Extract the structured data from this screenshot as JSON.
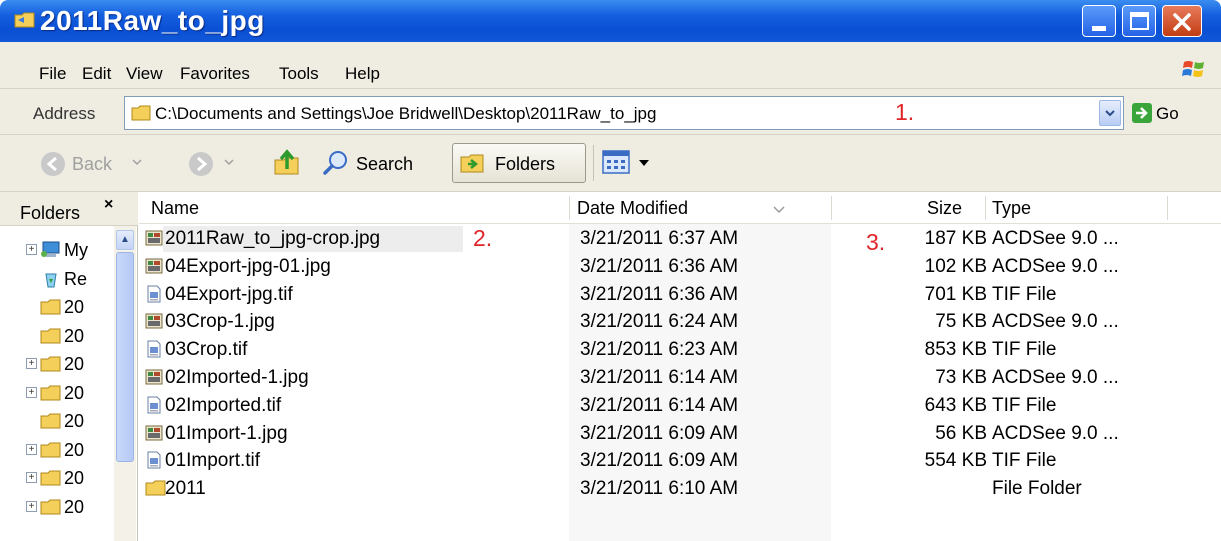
{
  "window": {
    "title": "2011Raw_to_jpg"
  },
  "menu": {
    "items": [
      "File",
      "Edit",
      "View",
      "Favorites",
      "Tools",
      "Help"
    ]
  },
  "address": {
    "label": "Address",
    "value": "C:\\Documents and Settings\\Joe Bridwell\\Desktop\\2011Raw_to_jpg",
    "go_label": "Go"
  },
  "annotations": {
    "a1": "1.",
    "a2": "2.",
    "a3": "3."
  },
  "toolbar": {
    "back_label": "Back",
    "search_label": "Search",
    "folders_label": "Folders"
  },
  "folders_pane": {
    "title": "Folders",
    "close": "×",
    "tree": [
      {
        "label": "My",
        "icon": "my-computer-icon",
        "expander": true
      },
      {
        "label": "Re",
        "icon": "recycle-bin-icon",
        "expander": false
      },
      {
        "label": "20",
        "icon": "folder-icon",
        "expander": false
      },
      {
        "label": "20",
        "icon": "folder-icon",
        "expander": false
      },
      {
        "label": "20",
        "icon": "folder-icon",
        "expander": true
      },
      {
        "label": "20",
        "icon": "folder-icon",
        "expander": true
      },
      {
        "label": "20",
        "icon": "folder-icon",
        "expander": false
      },
      {
        "label": "20",
        "icon": "folder-icon",
        "expander": true
      },
      {
        "label": "20",
        "icon": "folder-icon",
        "expander": true
      },
      {
        "label": "20",
        "icon": "folder-icon",
        "expander": true
      }
    ]
  },
  "columns": {
    "name": "Name",
    "date": "Date Modified",
    "size": "Size",
    "type": "Type"
  },
  "files": [
    {
      "name": "2011Raw_to_jpg-crop.jpg",
      "date": "3/21/2011 6:37 AM",
      "size": "187 KB",
      "type": "ACDSee 9.0 ...",
      "icon": "jpg-file-icon"
    },
    {
      "name": "04Export-jpg-01.jpg",
      "date": "3/21/2011 6:36 AM",
      "size": "102 KB",
      "type": "ACDSee 9.0 ...",
      "icon": "jpg-file-icon"
    },
    {
      "name": "04Export-jpg.tif",
      "date": "3/21/2011 6:36 AM",
      "size": "701 KB",
      "type": "TIF File",
      "icon": "tif-file-icon"
    },
    {
      "name": "03Crop-1.jpg",
      "date": "3/21/2011 6:24 AM",
      "size": "75 KB",
      "type": "ACDSee 9.0 ...",
      "icon": "jpg-file-icon"
    },
    {
      "name": "03Crop.tif",
      "date": "3/21/2011 6:23 AM",
      "size": "853 KB",
      "type": "TIF File",
      "icon": "tif-file-icon"
    },
    {
      "name": "02Imported-1.jpg",
      "date": "3/21/2011 6:14 AM",
      "size": "73 KB",
      "type": "ACDSee 9.0 ...",
      "icon": "jpg-file-icon"
    },
    {
      "name": "02Imported.tif",
      "date": "3/21/2011 6:14 AM",
      "size": "643 KB",
      "type": "TIF File",
      "icon": "tif-file-icon"
    },
    {
      "name": "01Import-1.jpg",
      "date": "3/21/2011 6:09 AM",
      "size": "56 KB",
      "type": "ACDSee 9.0 ...",
      "icon": "jpg-file-icon"
    },
    {
      "name": "01Import.tif",
      "date": "3/21/2011 6:09 AM",
      "size": "554 KB",
      "type": "TIF File",
      "icon": "tif-file-icon"
    },
    {
      "name": "2011",
      "date": "3/21/2011 6:10 AM",
      "size": "",
      "type": "File Folder",
      "icon": "folder-icon"
    }
  ],
  "colors": {
    "titlebar": "#0a4fd4",
    "chrome": "#efede2",
    "annotation": "#e0242a"
  }
}
